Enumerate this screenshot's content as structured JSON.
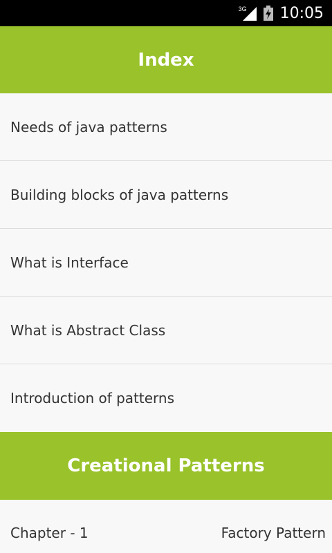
{
  "status_bar": {
    "network": "3G",
    "signal_icon": "signal-icon",
    "battery_icon": "battery-charging-icon",
    "time": "10:05"
  },
  "header": {
    "title": "Index",
    "color": "#99c22b"
  },
  "index_items": [
    {
      "label": "Needs of java patterns"
    },
    {
      "label": "Building blocks of java patterns"
    },
    {
      "label": "What is Interface"
    },
    {
      "label": "What is Abstract Class"
    },
    {
      "label": "Introduction of patterns"
    }
  ],
  "section": {
    "title": "Creational Patterns"
  },
  "chapters": [
    {
      "chapter": "Chapter - 1",
      "title": "Factory Pattern"
    }
  ]
}
